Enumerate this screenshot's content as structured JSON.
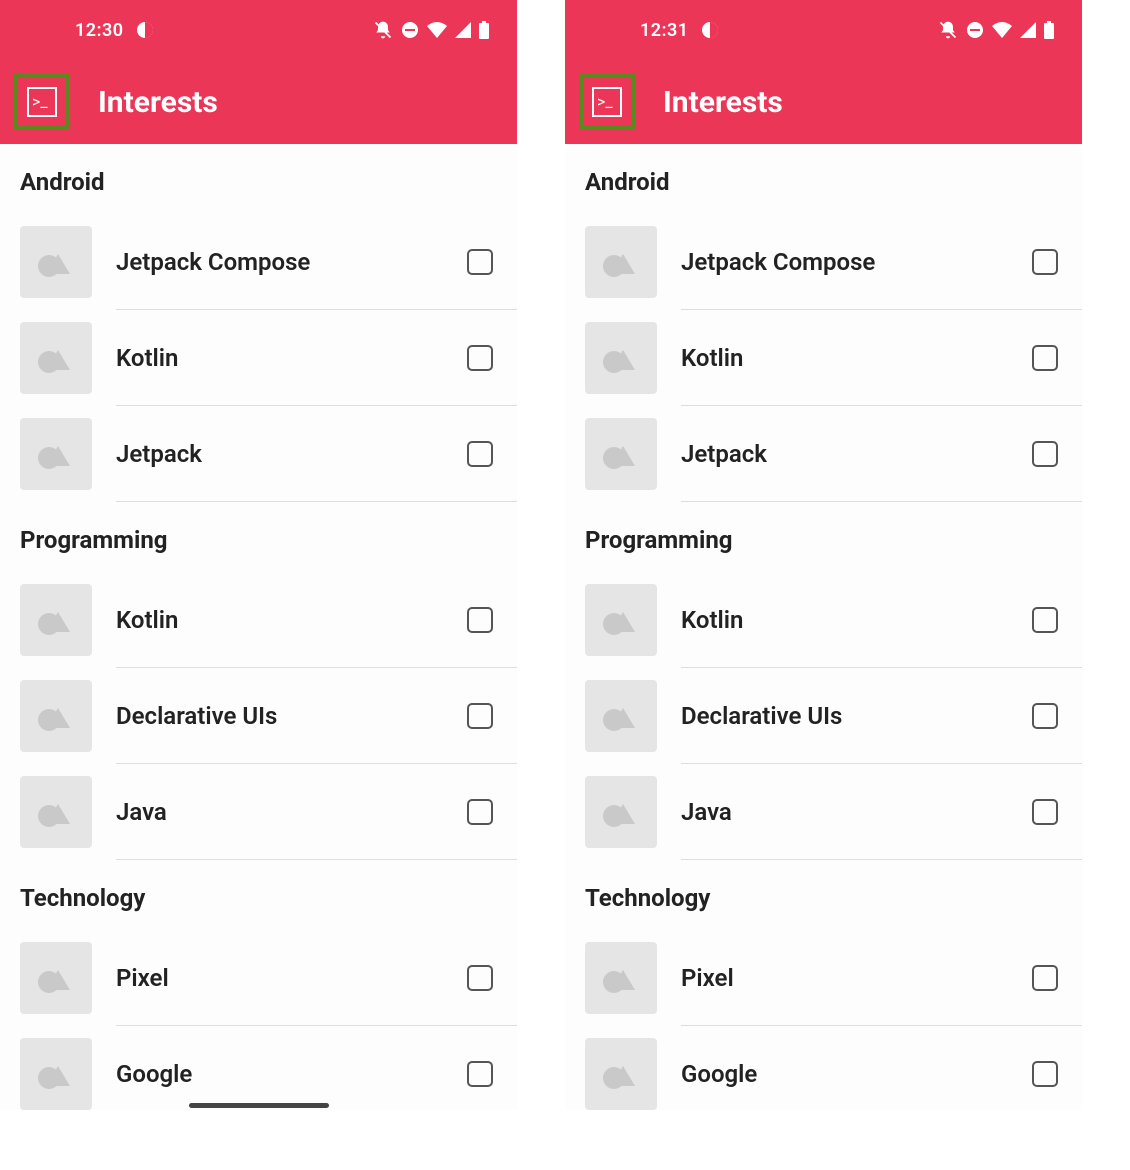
{
  "screens": [
    {
      "status_time": "12:30",
      "app_title": "Interests",
      "sections": [
        {
          "header": "Android",
          "items": [
            {
              "label": "Jetpack Compose"
            },
            {
              "label": "Kotlin"
            },
            {
              "label": "Jetpack"
            }
          ]
        },
        {
          "header": "Programming",
          "items": [
            {
              "label": "Kotlin"
            },
            {
              "label": "Declarative UIs"
            },
            {
              "label": "Java"
            }
          ]
        },
        {
          "header": "Technology",
          "items": [
            {
              "label": "Pixel"
            },
            {
              "label": "Google"
            }
          ]
        }
      ]
    },
    {
      "status_time": "12:31",
      "app_title": "Interests",
      "sections": [
        {
          "header": "Android",
          "items": [
            {
              "label": "Jetpack Compose"
            },
            {
              "label": "Kotlin"
            },
            {
              "label": "Jetpack"
            }
          ]
        },
        {
          "header": "Programming",
          "items": [
            {
              "label": "Kotlin"
            },
            {
              "label": "Declarative UIs"
            },
            {
              "label": "Java"
            }
          ]
        },
        {
          "header": "Technology",
          "items": [
            {
              "label": "Pixel"
            },
            {
              "label": "Google"
            }
          ]
        }
      ]
    }
  ],
  "colors": {
    "accent": "#ec3658",
    "highlight_border": "#5a8a1f"
  }
}
